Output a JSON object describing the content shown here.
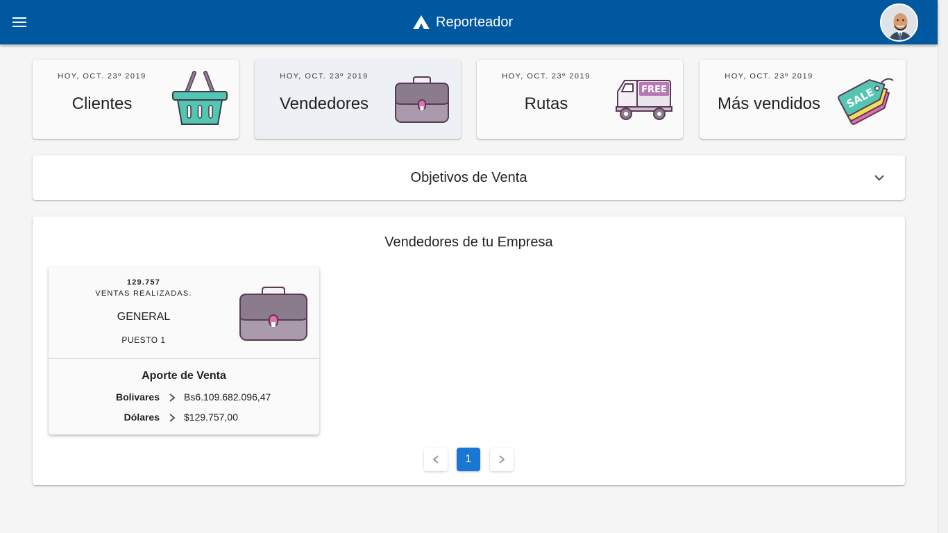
{
  "header": {
    "title": "Reporteador",
    "menu_icon": "menu-icon",
    "logo_icon": "brand-logo-icon",
    "avatar_icon": "user-avatar-icon",
    "colors": {
      "appbar": "#0058a0"
    }
  },
  "cards": [
    {
      "date": "HOY, OCT. 23º 2019",
      "label": "Clientes",
      "icon": "basket-icon"
    },
    {
      "date": "HOY, OCT. 23º 2019",
      "label": "Vendedores",
      "icon": "briefcase-icon",
      "selected": true
    },
    {
      "date": "HOY, OCT. 23º 2019",
      "label": "Rutas",
      "icon": "delivery-truck-icon"
    },
    {
      "date": "HOY, OCT. 23º 2019",
      "label": "Más vendidos",
      "icon": "sale-tag-icon"
    }
  ],
  "objetivos": {
    "title": "Objetivos de Venta",
    "icon": "chevron-down-icon"
  },
  "vendedores": {
    "title": "Vendedores de tu Empresa",
    "items": [
      {
        "ventas_count": "129.757",
        "ventas_label": "VENTAS REALIZADAS.",
        "name": "GENERAL",
        "rank": "PUESTO 1",
        "icon": "briefcase-icon",
        "aporte_title": "Aporte de Venta",
        "bolivares_label": "Bolivares",
        "bolivares_value": "Bs6.109.682.096,47",
        "dolares_label": "Dólares",
        "dolares_value": "$129.757,00"
      }
    ]
  },
  "pagination": {
    "prev_icon": "chevron-left-icon",
    "next_icon": "chevron-right-icon",
    "current_page": "1",
    "colors": {
      "current": "#1976d2"
    }
  }
}
